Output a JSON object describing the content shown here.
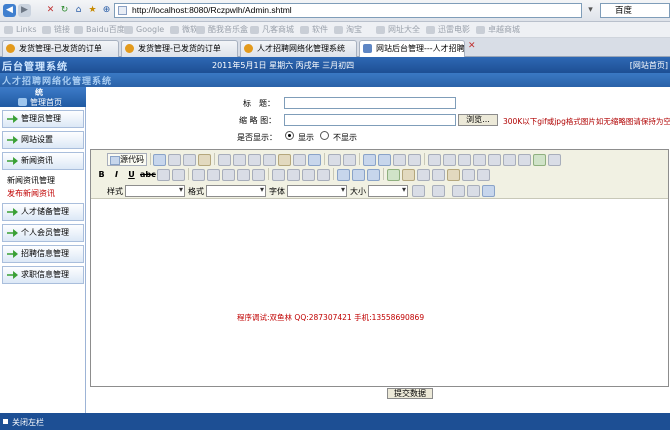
{
  "browser": {
    "url": "http://localhost:8080/Rczpwlh/Admin.shtml",
    "search_placeholder": "百度",
    "bookmarks": [
      "Links",
      "链接",
      "Baidu百度",
      "Google",
      "微软",
      "酷我音乐盒",
      "凡客商城",
      "软件",
      "淘宝",
      "网址大全",
      "迅雷电影",
      "卓越商城"
    ],
    "tabs": [
      {
        "label": "发货管理-已发货的订单"
      },
      {
        "label": "发货管理-已发货的订单"
      },
      {
        "label": "人才招聘网络化管理系统"
      },
      {
        "label": "网站后台管理---人才招聘..."
      }
    ]
  },
  "header": {
    "logo": "后台管理系统",
    "date": "2011年5月1日 星期六 丙戌年 三月初四",
    "home_link": "[网站首页]",
    "system_name": "人才招聘网络化管理系统"
  },
  "sidebar": {
    "top_label": "统",
    "home_label": "管理首页",
    "menus": [
      {
        "label": "管理员管理"
      },
      {
        "label": "网站设置"
      },
      {
        "label": "新闻资讯"
      },
      {
        "label": "人才储备管理"
      },
      {
        "label": "个人会员管理"
      },
      {
        "label": "招聘信息管理"
      },
      {
        "label": "求职信息管理"
      }
    ],
    "subitems": [
      {
        "label": "新闻资讯管理"
      },
      {
        "label": "发布新闻资讯"
      }
    ]
  },
  "form": {
    "title_label": "标　题：",
    "thumb_label": "缩 略 图：",
    "browse_label": "浏览...",
    "thumb_hint": "300K以下gif或jpg格式图片如无缩略图请保持为空",
    "show_label": "是否显示：",
    "show_yes": "显示",
    "show_no": "不显示",
    "submit_label": "提交数据"
  },
  "editor": {
    "source_label": "源代码",
    "style_label": "样式",
    "format_label": "格式",
    "font_label": "字体",
    "size_label": "大小",
    "content": "程序调试:双鱼林 QQ:287307421 手机:13558690869"
  },
  "footer": {
    "close_sidebar": "关闭左栏"
  }
}
